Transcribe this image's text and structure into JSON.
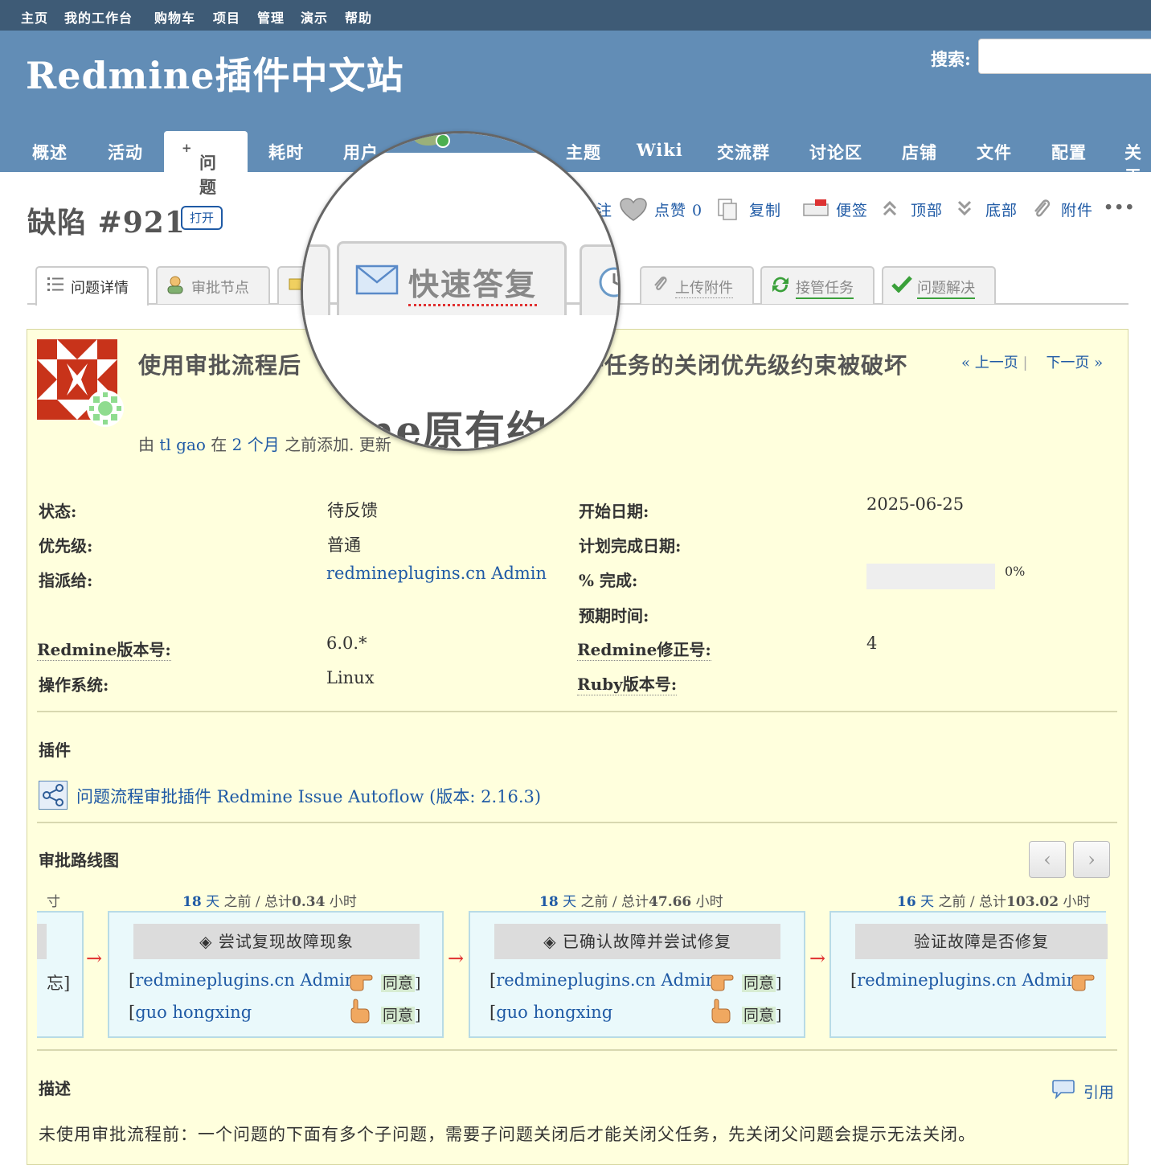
{
  "top_menu": [
    "主页",
    "我的工作台",
    "购物车",
    "项目",
    "管理",
    "演示",
    "帮助"
  ],
  "header": {
    "site_title": "Redmine插件中文站",
    "search_label": "搜索:"
  },
  "main_menu": [
    "概述",
    "活动",
    "问题",
    "耗时",
    "用户",
    "主题",
    "Wiki",
    "交流群",
    "讨论区",
    "店铺",
    "文件",
    "配置",
    "关于"
  ],
  "issue": {
    "title": "缺陷 #921",
    "status_badge": "打开",
    "actions": {
      "watch": "注",
      "like": "点赞 0",
      "copy": "复制",
      "note": "便签",
      "top": "顶部",
      "bottom": "底部",
      "attach": "附件",
      "more": "•••"
    },
    "subject": "使用审批流程后　　　　　　　　　　　与子任务的关闭优先级约束被破坏",
    "author_prefix": "由",
    "author": "tl gao",
    "author_mid": "在",
    "time_ago": "2 个月",
    "author_suffix": "之前添加. 更新",
    "prev": "« 上一页",
    "next": "下一页 »"
  },
  "subtabs": {
    "details": "问题详情",
    "approval_nodes": "审批节点",
    "upload": "上传附件",
    "take_over": "接管任务",
    "resolve": "问题解决"
  },
  "magnifier": {
    "tab_label": "快速答复",
    "partial_text": "ine原有约"
  },
  "attributes": {
    "status_label": "状态:",
    "status": "待反馈",
    "priority_label": "优先级:",
    "priority": "普通",
    "assignee_label": "指派给:",
    "assignee": "redmineplugins.cn Admin",
    "start_label": "开始日期:",
    "start": "2025-06-25",
    "due_label": "计划完成日期:",
    "done_label": "% 完成:",
    "done": "0%",
    "done_ratio": 0,
    "estimate_label": "预期时间:",
    "redmine_ver_label": "Redmine版本号:",
    "redmine_ver": "6.0.*",
    "os_label": "操作系统:",
    "os": "Linux",
    "patch_label": "Redmine修正号:",
    "patch": "4",
    "ruby_label": "Ruby版本号:"
  },
  "plugin": {
    "section": "插件",
    "link": "问题流程审批插件 Redmine Issue Autoflow (版本: 2.16.3)"
  },
  "approval": {
    "section": "审批路线图",
    "left_partial_time": "寸",
    "left_partial_row": "忘]",
    "nodes": [
      {
        "days": "18",
        "unit": "天",
        "ago": "之前 / 总计",
        "hours": "0.34",
        "hunit": "小时",
        "title": "尝试复现故障现象",
        "r1_name": "redmineplugins.cn Admin",
        "r1_tag": "同意",
        "r2_name": "guo hongxing",
        "r2_tag": "同意"
      },
      {
        "days": "18",
        "unit": "天",
        "ago": "之前 / 总计",
        "hours": "47.66",
        "hunit": "小时",
        "title": "已确认故障并尝试修复",
        "r1_name": "redmineplugins.cn Admin",
        "r1_tag": "同意",
        "r2_name": "guo hongxing",
        "r2_tag": "同意"
      },
      {
        "days": "16",
        "unit": "天",
        "ago": "之前 / 总计",
        "hours": "103.02",
        "hunit": "小时",
        "title": "验证故障是否修复",
        "r1_name": "redmineplugins.cn Admin"
      }
    ]
  },
  "description": {
    "section": "描述",
    "quote": "引用",
    "text": "未使用审批流程前：一个问题的下面有多个子问题，需要子问题关闭后才能关闭父任务，先关闭父问题会提示无法关闭。"
  }
}
